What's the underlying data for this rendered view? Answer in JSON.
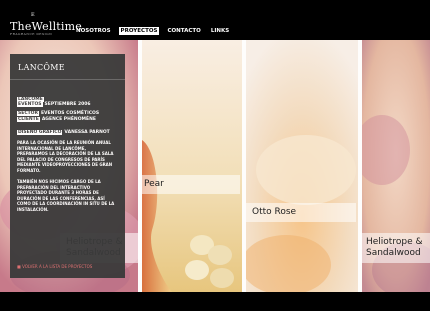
{
  "logo": {
    "main": "TheWelltime",
    "sup": "E",
    "sub": "FRAGRANCE DESIGN"
  },
  "nav": {
    "items": [
      "NOSOTROS",
      "PROYECTOS",
      "CONTACTO",
      "LINKS"
    ]
  },
  "info": {
    "title": "LANCÔME",
    "meta": [
      {
        "k": "LANCÔME",
        "v": ""
      },
      {
        "k": "EVENTOS",
        "v": "SEPTIEMBRE 2006"
      },
      {
        "k": "SECTOR",
        "v": "EVENTOS COSMÉTICOS"
      },
      {
        "k": "CLIENTE",
        "v": "AGENCE PHÉNOMÈNE"
      },
      {
        "k": "DISEÑO GRÁFICO",
        "v": "VANESSA PARNOT"
      }
    ],
    "desc1": "PARA LA OCASIÓN DE LA REUNIÓN ANUAL INTERNACIONAL DE LANCÔME, PREPARAMOS LA DECORACIÓN DE LA SALA DEL PALACIO DE CONGRESOS DE PARÍS MEDIANTE VIDEOPROYECCIONES DE GRAN FORMATO.",
    "desc2": "TAMBIÉN NOS HICIMOS CARGO DE LA PREPARACIÓN DEL INTERACTIVO PROYECTADO DURANTE 3 HORAS DE DURACIÓN DE LAS CONFERENCIAS, ASÍ COMO DE LA COORDINACIÓN IN SITU DE LA INSTALACIÓN.",
    "back": "VOLVER A LA LISTA DE PROYECTOS"
  },
  "captions": {
    "c1": "Heliotrope & Sandalwood",
    "c2": "Pear",
    "c3": "Otto Rose",
    "c4": "Heliotrope & Sandalwood"
  },
  "colors": {
    "accent": "#e07070",
    "box": "#3a3a3a"
  }
}
